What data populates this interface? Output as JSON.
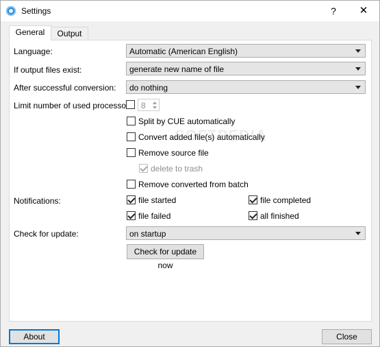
{
  "window": {
    "title": "Settings",
    "help_label": "?",
    "close_label": "✕",
    "app_icon": "app-logo-icon"
  },
  "tabs": [
    {
      "label": "General"
    },
    {
      "label": "Output"
    }
  ],
  "general": {
    "language": {
      "label": "Language:",
      "value": "Automatic (American English)"
    },
    "output_exists": {
      "label": "If output files exist:",
      "value": "generate new name of file"
    },
    "after_conversion": {
      "label": "After successful conversion:",
      "value": "do nothing"
    },
    "processors": {
      "label": "Limit number of used processors:",
      "checked": false,
      "value": "8"
    },
    "split_cue": {
      "label": "Split by CUE automatically",
      "checked": false
    },
    "convert_added": {
      "label": "Convert added file(s) automatically",
      "checked": false
    },
    "remove_source": {
      "label": "Remove source file",
      "checked": false
    },
    "delete_to_trash": {
      "label": "delete to trash",
      "checked": true,
      "disabled": true
    },
    "remove_converted": {
      "label": "Remove converted from batch",
      "checked": false
    },
    "notifications": {
      "label": "Notifications:",
      "file_started": {
        "label": "file started",
        "checked": true
      },
      "file_completed": {
        "label": "file completed",
        "checked": true
      },
      "file_failed": {
        "label": "file failed",
        "checked": true
      },
      "all_finished": {
        "label": "all finished",
        "checked": true
      }
    },
    "update": {
      "label": "Check for update:",
      "value": "on startup",
      "button": "Check for update now"
    }
  },
  "footer": {
    "about": "About",
    "close": "Close"
  },
  "watermark": "SOFTPEDIA"
}
